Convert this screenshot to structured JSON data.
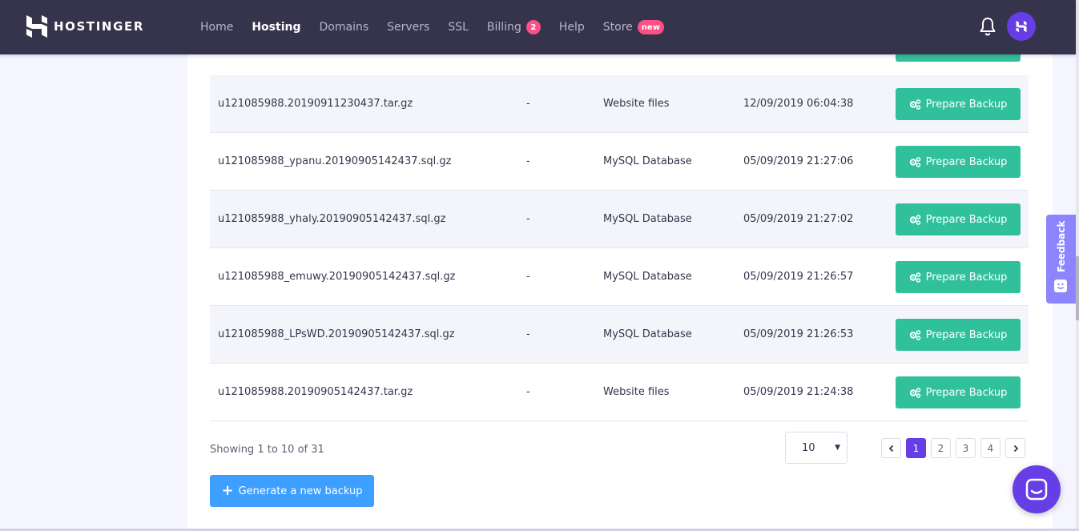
{
  "brand": {
    "name": "HOSTINGER"
  },
  "nav": {
    "items": [
      {
        "label": "Home",
        "active": false
      },
      {
        "label": "Hosting",
        "active": true
      },
      {
        "label": "Domains",
        "active": false
      },
      {
        "label": "Servers",
        "active": false
      },
      {
        "label": "SSL",
        "active": false
      },
      {
        "label": "Billing",
        "active": false,
        "badge": "2"
      },
      {
        "label": "Help",
        "active": false
      },
      {
        "label": "Store",
        "active": false,
        "badge": "new"
      }
    ]
  },
  "icons": {
    "bell": "bell-icon",
    "avatar": "hostinger-avatar",
    "prepare": "gears-icon",
    "chat": "chat-icon",
    "feedback": "smile-icon"
  },
  "colors": {
    "navbar": "#36344d",
    "accent": "#673de6",
    "success": "#31c09c",
    "primary_button": "#3d9fff",
    "badge": "#fc5185",
    "feedback": "#8c85ff"
  },
  "backups": {
    "button_label": "Prepare Backup",
    "rows": [
      {
        "name": "u121085988.20190911230437.tar.gz",
        "size": "-",
        "type": "Website files",
        "date": "12/09/2019 06:04:38"
      },
      {
        "name": "u121085988_ypanu.20190905142437.sql.gz",
        "size": "-",
        "type": "MySQL Database",
        "date": "05/09/2019 21:27:06"
      },
      {
        "name": "u121085988_yhaly.20190905142437.sql.gz",
        "size": "-",
        "type": "MySQL Database",
        "date": "05/09/2019 21:27:02"
      },
      {
        "name": "u121085988_emuwy.20190905142437.sql.gz",
        "size": "-",
        "type": "MySQL Database",
        "date": "05/09/2019 21:26:57"
      },
      {
        "name": "u121085988_LPsWD.20190905142437.sql.gz",
        "size": "-",
        "type": "MySQL Database",
        "date": "05/09/2019 21:26:53"
      },
      {
        "name": "u121085988.20190905142437.tar.gz",
        "size": "-",
        "type": "Website files",
        "date": "05/09/2019 21:24:38"
      }
    ]
  },
  "pagination": {
    "showing": "Showing 1 to 10 of 31",
    "per_page": "10",
    "pages": [
      "1",
      "2",
      "3",
      "4"
    ],
    "current": "1"
  },
  "actions": {
    "generate": "Generate a new backup"
  },
  "feedback": {
    "label": "Feedback"
  }
}
